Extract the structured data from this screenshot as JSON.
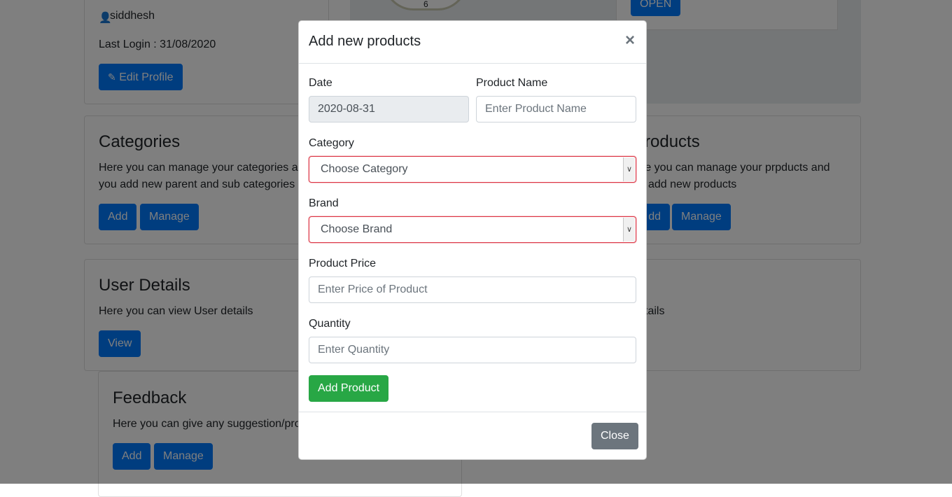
{
  "profile": {
    "username": "siddhesh",
    "last_login": "Last Login : 31/08/2020",
    "edit_label": "Edit Profile"
  },
  "top_right": {
    "open_label": "OPEN"
  },
  "clock": {
    "numeral": "6"
  },
  "categories": {
    "title": "Categories",
    "text_line1": "Here you can manage your categories an",
    "text_line2": "you add new parent and sub categories",
    "add_label": "Add",
    "manage_label": "Manage"
  },
  "products": {
    "title": "roducts",
    "text_line1": "re you can manage your prpducts and",
    "text_line2": "add new products",
    "add_label": "dd",
    "manage_label": "Manage"
  },
  "user_details": {
    "title": "User Details",
    "text": "Here you can view User details",
    "view_label": "View"
  },
  "right_details": {
    "text": "tails"
  },
  "feedback": {
    "title": "Feedback",
    "text": "Here you can give any suggestion/pro",
    "add_label": "Add",
    "manage_label": "Manage"
  },
  "modal": {
    "title": "Add new products",
    "close_symbol": "×",
    "date_label": "Date",
    "date_value": "2020-08-31",
    "name_label": "Product Name",
    "name_placeholder": "Enter Product Name",
    "category_label": "Category",
    "category_selected": "Choose Category",
    "brand_label": "Brand",
    "brand_selected": "Choose Brand",
    "price_label": "Product Price",
    "price_placeholder": "Enter Price of Product",
    "quantity_label": "Quantity",
    "quantity_placeholder": "Enter Quantity",
    "submit_label": "Add Product",
    "close_label": "Close"
  },
  "colors": {
    "primary": "#007bff",
    "success": "#28a745",
    "secondary": "#6c757d",
    "danger": "#dc3545"
  }
}
